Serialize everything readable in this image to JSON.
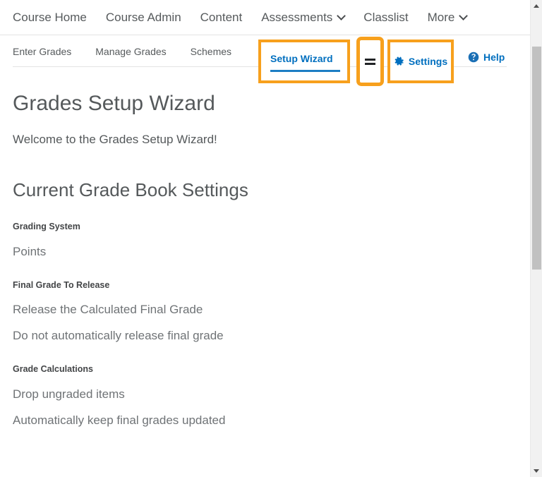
{
  "top_nav": {
    "items": [
      {
        "label": "Course Home",
        "has_chevron": false
      },
      {
        "label": "Course Admin",
        "has_chevron": false
      },
      {
        "label": "Content",
        "has_chevron": false
      },
      {
        "label": "Assessments",
        "has_chevron": true
      },
      {
        "label": "Classlist",
        "has_chevron": false
      },
      {
        "label": "More",
        "has_chevron": true
      }
    ]
  },
  "sub_nav": {
    "items": [
      {
        "label": "Enter Grades",
        "active": false
      },
      {
        "label": "Manage Grades",
        "active": false
      },
      {
        "label": "Schemes",
        "active": false
      }
    ],
    "active_tab": "Setup Wizard",
    "equals_icon": "equals-icon",
    "settings_label": "Settings",
    "settings_icon": "gear-icon",
    "help_label": "Help",
    "help_icon": "help-circle-icon"
  },
  "main": {
    "page_title": "Grades Setup Wizard",
    "intro": "Welcome to the Grades Setup Wizard!",
    "section_heading": "Current Grade Book Settings",
    "sections": [
      {
        "label": "Grading System",
        "values": [
          "Points"
        ]
      },
      {
        "label": "Final Grade To Release",
        "values": [
          "Release the Calculated Final Grade",
          "Do not automatically release final grade"
        ]
      },
      {
        "label": "Grade Calculations",
        "values": [
          "Drop ungraded items",
          "Automatically keep final grades updated"
        ]
      }
    ]
  },
  "scrollbar": {
    "up_icon": "scroll-up-arrow-icon",
    "down_icon": "scroll-down-arrow-icon"
  },
  "colors": {
    "highlight": "#f7a01d",
    "link": "#006fbf",
    "text": "#55595b",
    "accent_underline": "#1d7ec4"
  }
}
